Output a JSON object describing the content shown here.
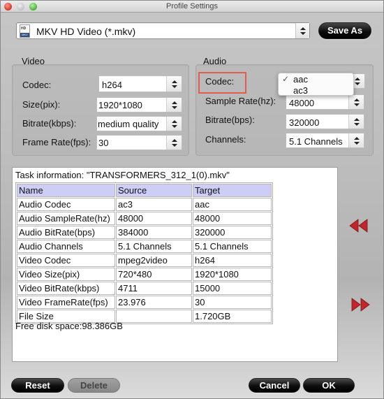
{
  "window": {
    "title": "Profile Settings"
  },
  "profile": {
    "icon": "mkv-file-icon",
    "icon_top_text": "HD",
    "icon_bottom_text": "MKV",
    "selected": "MKV HD Video (*.mkv)"
  },
  "toolbar": {
    "save_as_label": "Save As"
  },
  "video": {
    "group_label": "Video",
    "fields": [
      {
        "label": "Codec:",
        "value": "h264"
      },
      {
        "label": "Size(pix):",
        "value": "1920*1080"
      },
      {
        "label": "Bitrate(kbps):",
        "value": "medium quality"
      },
      {
        "label": "Frame Rate(fps):",
        "value": "30"
      }
    ]
  },
  "audio": {
    "group_label": "Audio",
    "highlight_color": "#e45a50",
    "fields": [
      {
        "label": "Codec:",
        "value": "aac"
      },
      {
        "label": "Sample Rate(hz):",
        "value": "48000"
      },
      {
        "label": "Bitrate(bps):",
        "value": "320000"
      },
      {
        "label": "Channels:",
        "value": "5.1 Channels"
      }
    ],
    "codec_dropdown": {
      "options": [
        {
          "label": "aac",
          "checked": true,
          "check_glyph": "✓"
        },
        {
          "label": "ac3",
          "checked": false,
          "check_glyph": ""
        }
      ]
    }
  },
  "task": {
    "title": "Task information: \"TRANSFORMERS_312_1(0).mkv\"",
    "header_color": "#cdcdf8",
    "columns": [
      "Name",
      "Source",
      "Target"
    ],
    "rows": [
      [
        "Audio Codec",
        "ac3",
        "aac"
      ],
      [
        "Audio SampleRate(hz)",
        "48000",
        "48000"
      ],
      [
        "Audio BitRate(bps)",
        "384000",
        "320000"
      ],
      [
        "Audio Channels",
        "5.1 Channels",
        "5.1 Channels"
      ],
      [
        "Video Codec",
        "mpeg2video",
        "h264"
      ],
      [
        "Video Size(pix)",
        "720*480",
        "1920*1080"
      ],
      [
        "Video BitRate(kbps)",
        "4711",
        "15000"
      ],
      [
        "Video FrameRate(fps)",
        "23.976",
        "30"
      ],
      [
        "File Size",
        "",
        "1.720GB"
      ]
    ],
    "free_disk": "Free disk space:98.386GB"
  },
  "side_controls": {
    "collapse_icon": "double-left-arrow-icon",
    "expand_icon": "double-right-arrow-icon",
    "arrow_color": "#c0262a"
  },
  "footer": {
    "reset_label": "Reset",
    "delete_label": "Delete",
    "cancel_label": "Cancel",
    "ok_label": "OK"
  }
}
